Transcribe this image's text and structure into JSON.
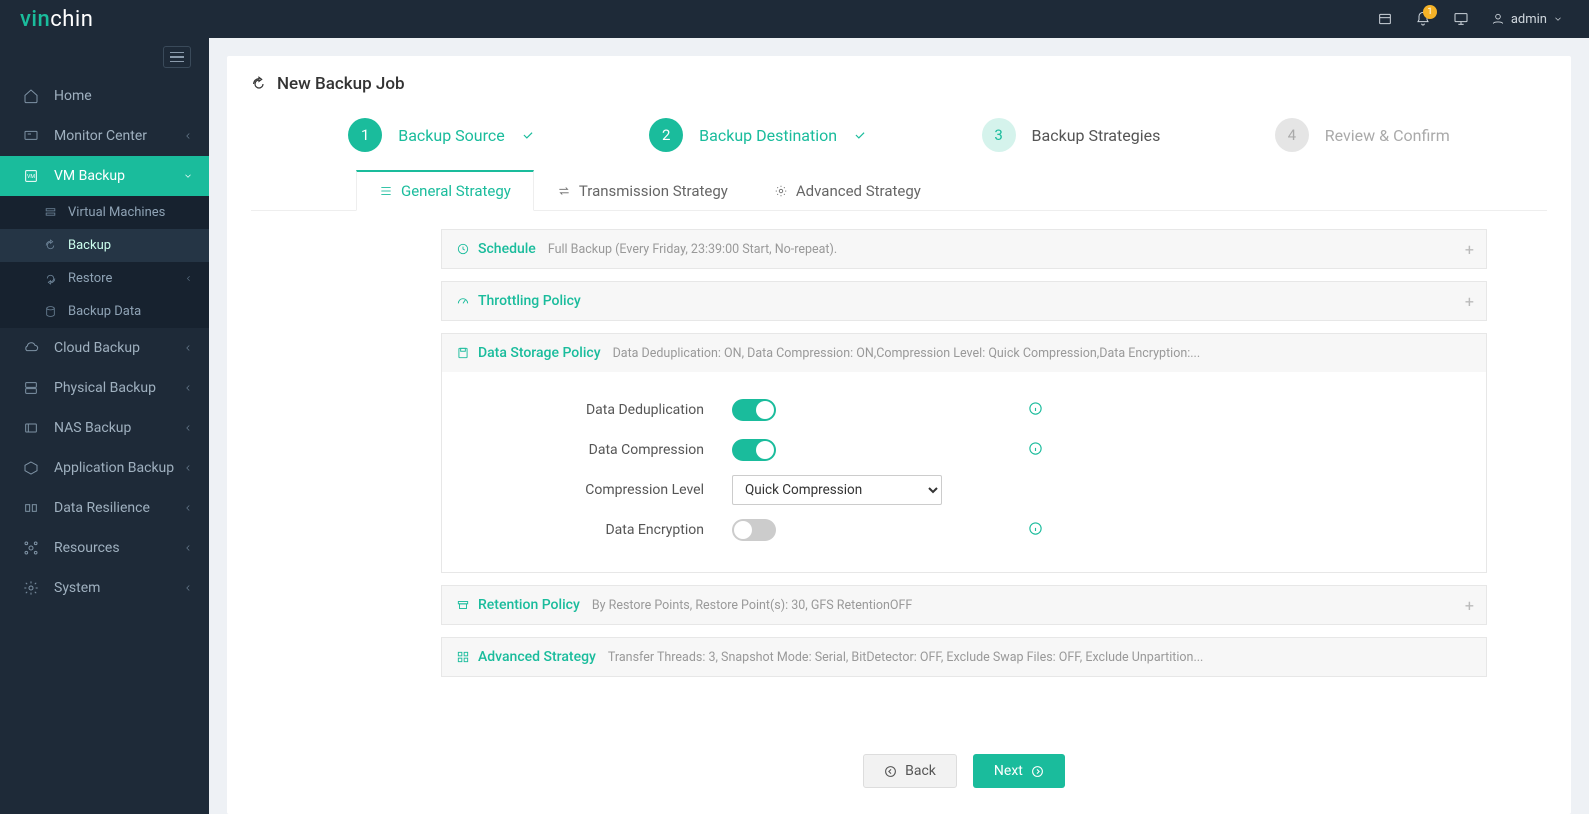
{
  "header": {
    "brand_left": "vin",
    "brand_right": "chin",
    "notif_count": "1",
    "user": "admin"
  },
  "sidebar": {
    "items": [
      {
        "label": "Home"
      },
      {
        "label": "Monitor Center"
      },
      {
        "label": "VM Backup"
      },
      {
        "label": "Cloud Backup"
      },
      {
        "label": "Physical Backup"
      },
      {
        "label": "NAS Backup"
      },
      {
        "label": "Application Backup"
      },
      {
        "label": "Data Resilience"
      },
      {
        "label": "Resources"
      },
      {
        "label": "System"
      }
    ],
    "vm_sub": [
      {
        "label": "Virtual Machines"
      },
      {
        "label": "Backup"
      },
      {
        "label": "Restore"
      },
      {
        "label": "Backup Data"
      }
    ]
  },
  "page": {
    "title": "New Backup Job",
    "steps": [
      {
        "num": "1",
        "label": "Backup Source"
      },
      {
        "num": "2",
        "label": "Backup Destination"
      },
      {
        "num": "3",
        "label": "Backup Strategies"
      },
      {
        "num": "4",
        "label": "Review & Confirm"
      }
    ],
    "tabs": [
      {
        "label": "General Strategy"
      },
      {
        "label": "Transmission Strategy"
      },
      {
        "label": "Advanced Strategy"
      }
    ],
    "panels": {
      "schedule": {
        "title": "Schedule",
        "summary": "Full Backup (Every Friday, 23:39:00 Start, No-repeat)."
      },
      "throttling": {
        "title": "Throttling Policy",
        "summary": ""
      },
      "storage": {
        "title": "Data Storage Policy",
        "summary": "Data Deduplication: ON, Data Compression: ON,Compression Level: Quick Compression,Data Encryption:...",
        "fields": {
          "dedup_label": "Data Deduplication",
          "dedup_on": true,
          "compress_label": "Data Compression",
          "compress_on": true,
          "level_label": "Compression Level",
          "level_value": "Quick Compression",
          "level_options": [
            "Quick Compression"
          ],
          "encrypt_label": "Data Encryption",
          "encrypt_on": false
        }
      },
      "retention": {
        "title": "Retention Policy",
        "summary": "By Restore Points, Restore Point(s): 30, GFS RetentionOFF"
      },
      "advanced": {
        "title": "Advanced Strategy",
        "summary": "Transfer Threads: 3, Snapshot Mode: Serial, BitDetector: OFF, Exclude Swap Files: OFF, Exclude Unpartition..."
      }
    },
    "buttons": {
      "back": "Back",
      "next": "Next"
    }
  }
}
